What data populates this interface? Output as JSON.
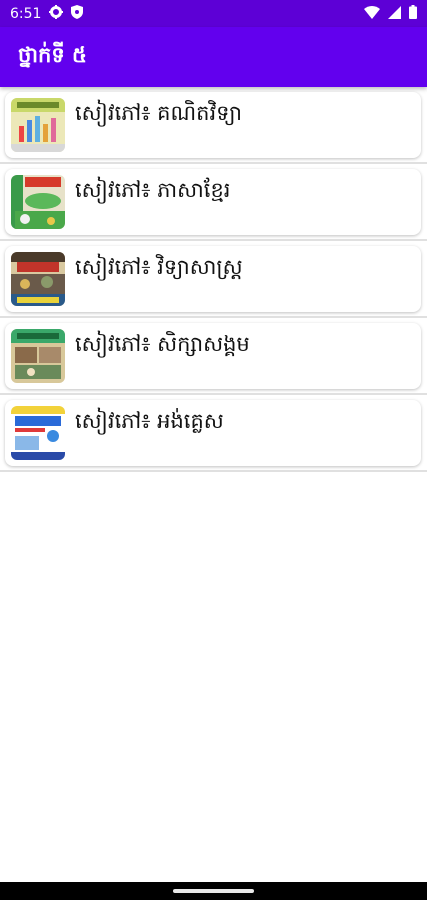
{
  "status_bar": {
    "time": "6:51",
    "icons": [
      "gear-icon",
      "shield-icon",
      "wifi-icon",
      "signal-icon",
      "battery-icon"
    ]
  },
  "app_bar": {
    "title": "ថ្នាក់ទី ៥"
  },
  "books": [
    {
      "label": "សៀវភៅ៖ គណិតវិទ្យា",
      "cover_colors": [
        "#e8e4b0",
        "#c9d86a",
        "#5fb0e0"
      ]
    },
    {
      "label": "សៀវភៅ៖ ភាសាខ្មែរ",
      "cover_colors": [
        "#4aa84a",
        "#e7e2c9",
        "#d63a2a"
      ]
    },
    {
      "label": "សៀវភៅ៖ វិទ្យាសាស្ត្រ",
      "cover_colors": [
        "#5a3a2a",
        "#d9b55a",
        "#c2342a"
      ]
    },
    {
      "label": "សៀវភៅ៖ សិក្សាសង្គម",
      "cover_colors": [
        "#3aa86a",
        "#d8c89a",
        "#8a6a4a"
      ]
    },
    {
      "label": "សៀវភៅ៖ អង់គ្លេស",
      "cover_colors": [
        "#ffffff",
        "#2a6ad8",
        "#f2d23a"
      ]
    }
  ],
  "colors": {
    "status_bar": "#5d00d6",
    "app_bar": "#6200ee"
  }
}
